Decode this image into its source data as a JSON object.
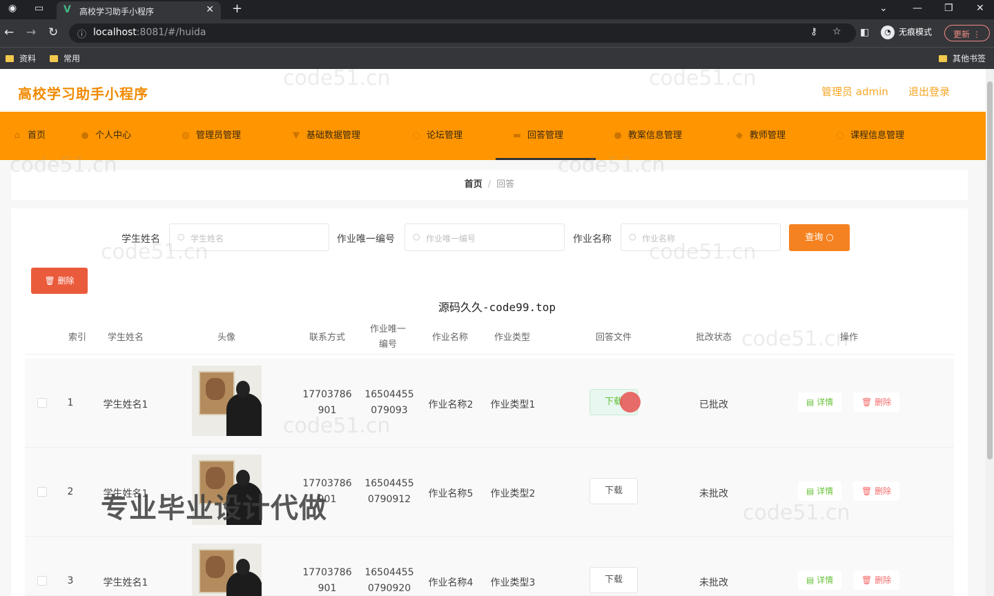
{
  "browser": {
    "tab_title": "高校学习助手小程序",
    "url_host": "localhost",
    "url_path": ":8081/#/huida",
    "incognito_label": "无痕模式",
    "update_label": "更新",
    "bookmarks": [
      "资料",
      "常用"
    ],
    "other_bookmarks": "其他书签"
  },
  "header": {
    "title": "高校学习助手小程序",
    "user_label": "管理员 admin",
    "logout_label": "退出登录"
  },
  "nav": {
    "items": [
      {
        "label": "首页",
        "icon": "home-icon"
      },
      {
        "label": "个人中心",
        "icon": "user-icon"
      },
      {
        "label": "管理员管理",
        "icon": "admin-icon"
      },
      {
        "label": "基础数据管理",
        "icon": "data-icon"
      },
      {
        "label": "论坛管理",
        "icon": "forum-icon"
      },
      {
        "label": "回答管理",
        "icon": "answer-icon"
      },
      {
        "label": "教案信息管理",
        "icon": "lesson-icon"
      },
      {
        "label": "教师管理",
        "icon": "teacher-icon"
      },
      {
        "label": "课程信息管理",
        "icon": "course-icon"
      }
    ],
    "active_index": 5
  },
  "breadcrumb": {
    "home": "首页",
    "current": "回答"
  },
  "search": {
    "student_name_label": "学生姓名",
    "student_name_placeholder": "学生姓名",
    "homework_id_label": "作业唯一编号",
    "homework_id_placeholder": "作业唯一编号",
    "homework_name_label": "作业名称",
    "homework_name_placeholder": "作业名称",
    "query_label": "查询"
  },
  "delete_button_label": "删除",
  "ad_text": "源码久久-code99.top",
  "table": {
    "headers": {
      "index": "索引",
      "student_name": "学生姓名",
      "avatar": "头像",
      "phone": "联系方式",
      "homework_id_line1": "作业唯一",
      "homework_id_line2": "编号",
      "homework_name": "作业名称",
      "homework_type": "作业类型",
      "answer_file": "回答文件",
      "review_status": "批改状态",
      "actions": "操作"
    },
    "rows": [
      {
        "index": "1",
        "student_name": "学生姓名1",
        "phone_1": "17703786",
        "phone_2": "901",
        "hw_id_1": "16504455",
        "hw_id_2": "079093",
        "homework_name": "作业名称2",
        "homework_type": "作业类型1",
        "download": "下载",
        "status": "已批改",
        "detail": "详情",
        "delete": "删除"
      },
      {
        "index": "2",
        "student_name": "学生姓名1",
        "phone_1": "17703786",
        "phone_2": "901",
        "hw_id_1": "16504455",
        "hw_id_2": "0790912",
        "homework_name": "作业名称5",
        "homework_type": "作业类型2",
        "download": "下载",
        "status": "未批改",
        "detail": "详情",
        "delete": "删除"
      },
      {
        "index": "3",
        "student_name": "学生姓名1",
        "phone_1": "17703786",
        "phone_2": "901",
        "hw_id_1": "16504455",
        "hw_id_2": "0790920",
        "homework_name": "作业名称4",
        "homework_type": "作业类型3",
        "download": "下载",
        "status": "未批改",
        "detail": "详情",
        "delete": "删除"
      }
    ]
  },
  "overlay_text": "专业毕业设计代做",
  "watermark_text": "code51.cn",
  "colors": {
    "accent": "#ff9500",
    "title": "#f08a00",
    "danger": "#ea5b3c",
    "success": "#67c23a"
  }
}
